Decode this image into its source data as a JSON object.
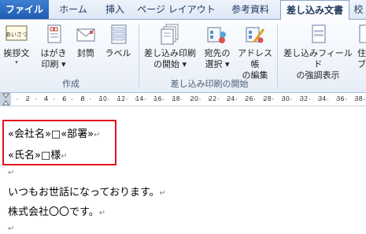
{
  "tabs": [
    "ファイル",
    "ホーム",
    "挿入",
    "ページ レイアウト",
    "参考資料",
    "差し込み文書",
    "校"
  ],
  "ribbon": {
    "groups": {
      "create": "作成",
      "start_merge": "差し込み印刷の開始"
    },
    "buttons": {
      "greeting": {
        "line1": "挨拶文",
        "line2": "▾"
      },
      "postcard": {
        "line1": "はがき",
        "line2": "印刷 ▾"
      },
      "envelope": {
        "line1": "封筒",
        "line2": ""
      },
      "label": {
        "line1": "ラベル",
        "line2": ""
      },
      "start_mail_merge": {
        "line1": "差し込み印刷",
        "line2": "の開始 ▾"
      },
      "select_recipients": {
        "line1": "宛先の",
        "line2": "選択 ▾"
      },
      "edit_list": {
        "line1": "アドレス帳",
        "line2": "の編集"
      },
      "highlight_fields": {
        "line1": "差し込みフィールド",
        "line2": "の強調表示"
      },
      "partial": {
        "line1": "住",
        "line2": "ブ"
      }
    },
    "icon_badge": "あいさつ"
  },
  "ruler": {
    "numbers": [
      "2",
      "4",
      "6",
      "8",
      "10",
      "12",
      "14",
      "16",
      "18",
      "20",
      "22",
      "24",
      "26",
      "28",
      "30",
      "32",
      "34",
      "36",
      "38"
    ]
  },
  "document": {
    "lines": [
      "«会社名»□«部署»",
      "«氏名»□様",
      "",
      "いつもお世話になっております。",
      "株式会社〇〇です。",
      ""
    ],
    "paragraph_mark": "↵",
    "line_break_mark": "↵"
  },
  "colors": {
    "file_tab": "#2a6bc3",
    "highlight_border": "#e0141e"
  }
}
